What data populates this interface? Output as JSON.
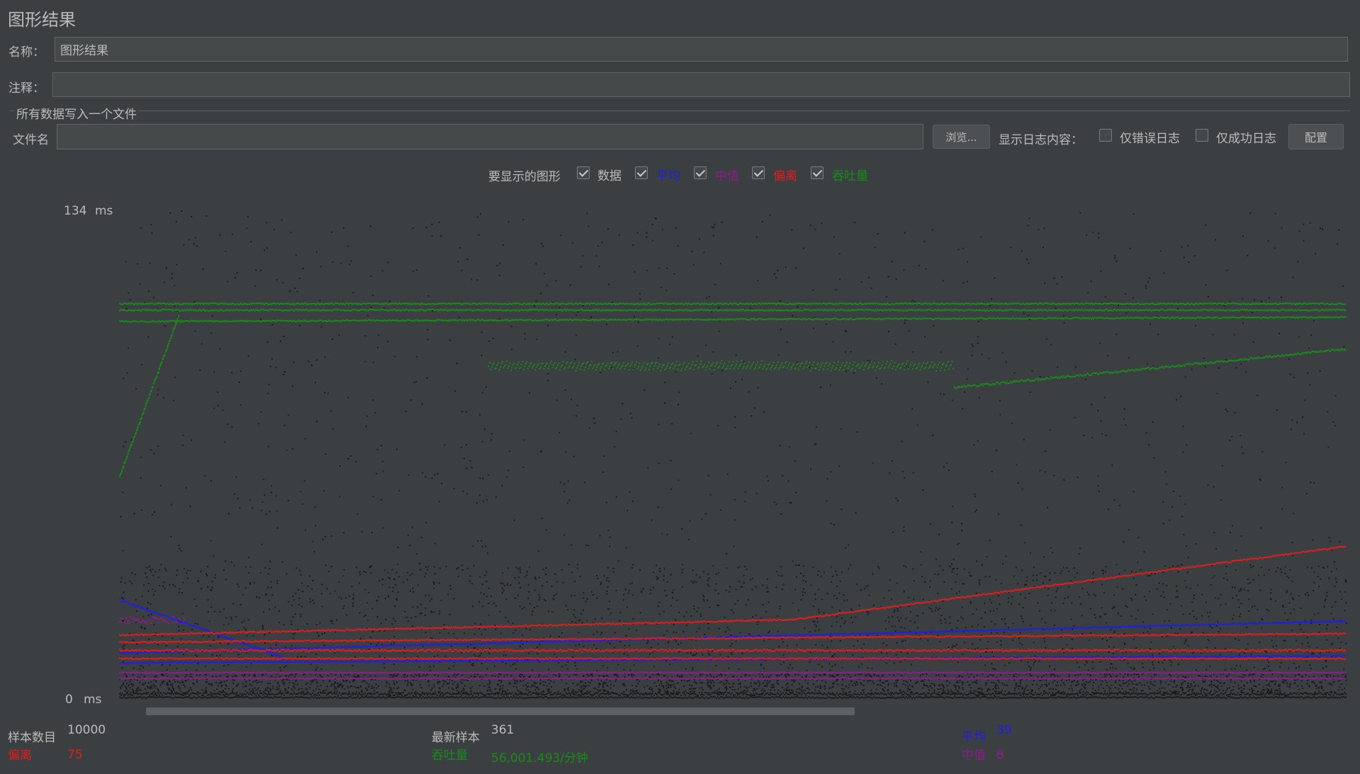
{
  "panel": {
    "title": "图形结果",
    "name_label": "名称：",
    "name_value": "图形结果",
    "comment_label": "注释：",
    "comment_value": ""
  },
  "file_section": {
    "legend": "所有数据写入一个文件",
    "filename_label": "文件名",
    "filename_value": "",
    "browse_label": "浏览...",
    "log_label": "显示日志内容：",
    "errors_only_label": "仅错误日志",
    "errors_only_checked": false,
    "success_only_label": "仅成功日志",
    "success_only_checked": false,
    "config_label": "配置"
  },
  "graph_options": {
    "label": "要显示的图形",
    "items": [
      {
        "label": "数据",
        "checked": true,
        "color": "#bbbbbb"
      },
      {
        "label": "平均",
        "checked": true,
        "color": "#1e1ee6"
      },
      {
        "label": "中值",
        "checked": true,
        "color": "#8a1e8a"
      },
      {
        "label": "偏离",
        "checked": true,
        "color": "#e01e1e"
      },
      {
        "label": "吞吐量",
        "checked": true,
        "color": "#1a8a1a"
      }
    ]
  },
  "axis": {
    "max_value": "134",
    "max_unit": "ms",
    "min_value": "0",
    "min_unit": "ms"
  },
  "chart_data": {
    "type": "scatter",
    "ylim": [
      0,
      134
    ],
    "y_unit": "ms",
    "series": [
      {
        "name": "数据",
        "color": "#1a1a1a"
      },
      {
        "name": "平均",
        "color": "#1e1ee6"
      },
      {
        "name": "中值",
        "color": "#8a1e8a"
      },
      {
        "name": "偏离",
        "color": "#e01e1e"
      },
      {
        "name": "吞吐量",
        "color": "#1a8a1a"
      }
    ]
  },
  "stats": {
    "samples_label": "样本数目",
    "samples_value": "10000",
    "latest_label": "最新样本",
    "latest_value": "361",
    "average_label": "平均",
    "average_value": "39",
    "deviation_label": "偏离",
    "deviation_value": "75",
    "throughput_label": "吞吐量",
    "throughput_value": "56,001.493/分钟",
    "median_label": "中值",
    "median_value": "8"
  },
  "colors": {
    "background": "#3c3f41",
    "average": "#1e1ee6",
    "median": "#8a1e8a",
    "deviation": "#e01e1e",
    "throughput": "#1a8a1a",
    "data": "#1a1a1a"
  }
}
